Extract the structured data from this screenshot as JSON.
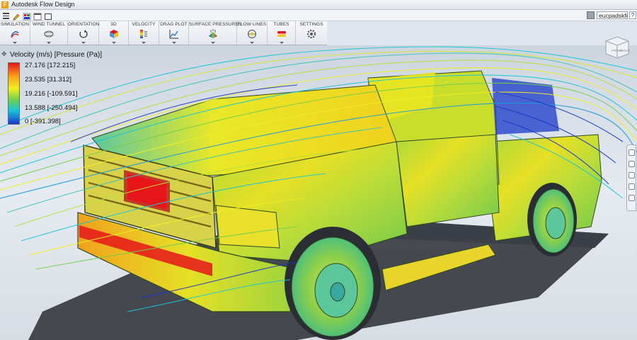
{
  "window": {
    "title": "Autodesk Flow Design",
    "logo_letter": "F"
  },
  "user": {
    "name": "eucpadskfd1",
    "help_label": "?"
  },
  "ribbon": {
    "tabs": [
      {
        "label": "SIMULATION",
        "icon": "simulation-icon"
      },
      {
        "label": "WIND TUNNEL",
        "icon": "wind-tunnel-icon"
      },
      {
        "label": "ORIENTATION",
        "icon": "orientation-icon"
      },
      {
        "label": "3D",
        "icon": "cube-3d-icon"
      },
      {
        "label": "VELOCITY",
        "icon": "velocity-icon"
      },
      {
        "label": "DRAG PLOT",
        "icon": "drag-plot-icon"
      },
      {
        "label": "SURFACE PRESSURES",
        "icon": "surface-pressures-icon"
      },
      {
        "label": "FLOW LINES",
        "icon": "flow-lines-icon"
      },
      {
        "label": "TUBES",
        "icon": "tubes-icon"
      },
      {
        "label": "SETTINGS",
        "icon": "settings-icon"
      }
    ]
  },
  "legend": {
    "title": "Velocity (m/s) [Pressure (Pa)]",
    "labels": [
      "27.176 [172.215]",
      "23.535 [31.312]",
      "19.216 [-109.591]",
      "13.588 [-250.494]",
      "0 [-391.398]"
    ],
    "colors": [
      "#e6151a",
      "#f7a21b",
      "#f1ef23",
      "#71cf4c",
      "#18c6d8",
      "#1a38c8"
    ]
  },
  "viewcube": {
    "front_label": "FRONT",
    "right_label": "RIGHT"
  }
}
